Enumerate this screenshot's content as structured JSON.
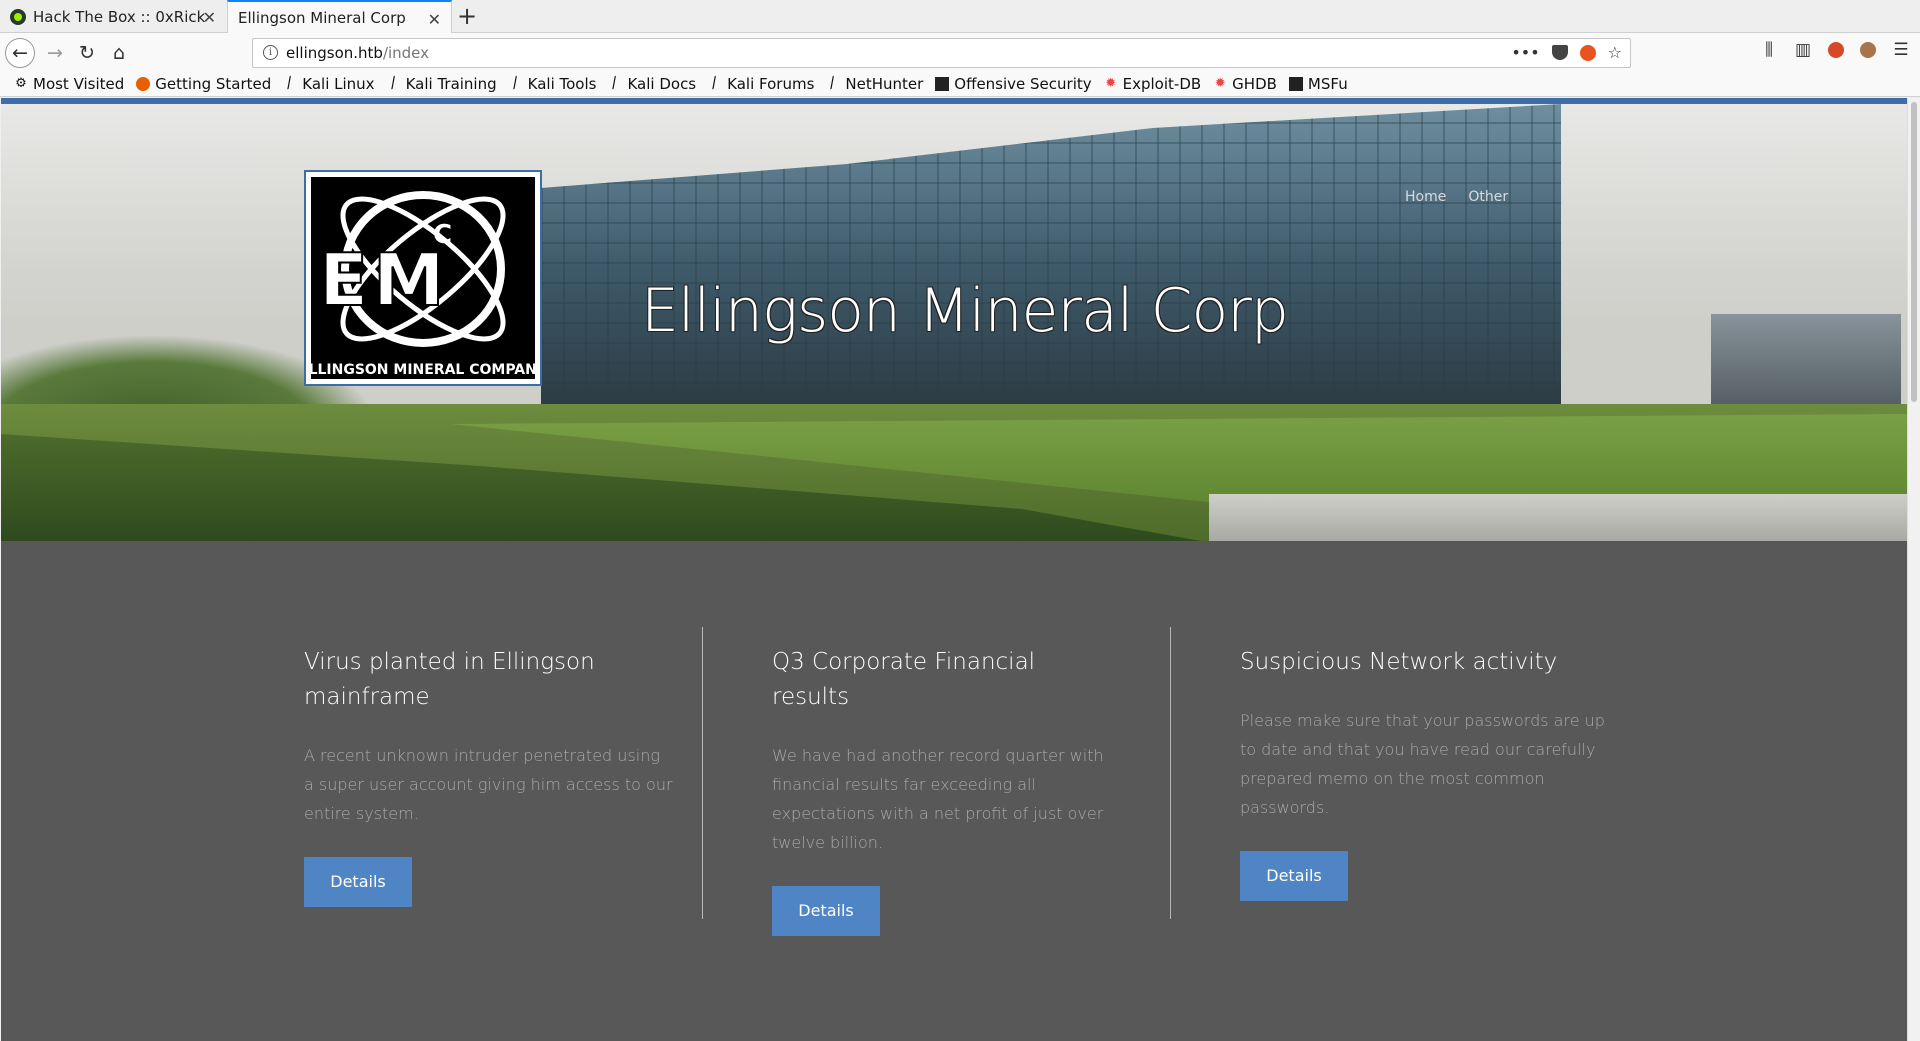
{
  "browser": {
    "tabs": [
      {
        "title": "Hack The Box :: 0xRick",
        "active": false
      },
      {
        "title": "Ellingson Mineral Corp",
        "active": true
      }
    ],
    "new_tab_label": "+",
    "url_host": "ellingson.htb",
    "url_path": "/index",
    "bookmarks": [
      {
        "label": "Most Visited",
        "icon": "gear-icon"
      },
      {
        "label": "Getting Started",
        "icon": "firefox-icon"
      },
      {
        "label": "Kali Linux",
        "icon": "kali-dragon-icon"
      },
      {
        "label": "Kali Training",
        "icon": "kali-dragon-icon"
      },
      {
        "label": "Kali Tools",
        "icon": "kali-dragon-icon"
      },
      {
        "label": "Kali Docs",
        "icon": "kali-dragon-icon"
      },
      {
        "label": "Kali Forums",
        "icon": "kali-dragon-icon"
      },
      {
        "label": "NetHunter",
        "icon": "kali-dragon-icon"
      },
      {
        "label": "Offensive Security",
        "icon": "offsec-icon"
      },
      {
        "label": "Exploit-DB",
        "icon": "exploitdb-icon"
      },
      {
        "label": "GHDB",
        "icon": "exploitdb-icon"
      },
      {
        "label": "MSFu",
        "icon": "offsec-icon"
      }
    ]
  },
  "hero": {
    "title": "Ellingson Mineral Corp",
    "logo_caption": "ELLINGSON MINERAL COMPANY",
    "nav": [
      "Home",
      "Other"
    ]
  },
  "articles": [
    {
      "title": "Virus planted in Ellingson mainframe",
      "body": "A recent unknown intruder penetrated using a super user account giving him access to our entire system.",
      "button": "Details"
    },
    {
      "title": "Q3 Corporate Financial results",
      "body": "We have had another record quarter with financial results far exceeding all expectations with a net profit of just over twelve billion.",
      "button": "Details"
    },
    {
      "title": "Suspicious Network activity",
      "body": "Please make sure that your passwords are up to date and that you have read our carefully prepared memo on the most common passwords.",
      "button": "Details"
    }
  ],
  "colors": {
    "page_bg": "#585858",
    "accent": "#4f85c4",
    "top_border": "#3d6ea9"
  }
}
